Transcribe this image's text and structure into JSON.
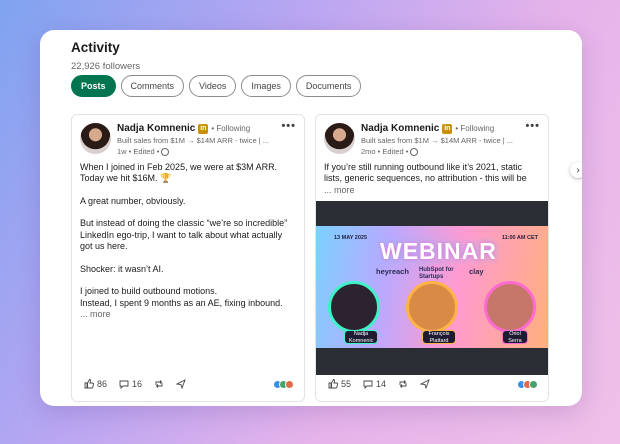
{
  "header": {
    "title": "Activity",
    "followers": "22,926 followers"
  },
  "tabs": [
    {
      "label": "Posts",
      "active": true
    },
    {
      "label": "Comments"
    },
    {
      "label": "Videos"
    },
    {
      "label": "Images"
    },
    {
      "label": "Documents"
    }
  ],
  "posts": [
    {
      "author": "Nadja Komnenic",
      "badge": "in",
      "following": "• Following",
      "headline": "Built sales from $1M → $14M ARR - twice | ...",
      "time": "1w • Edited •",
      "paragraphs": [
        "When I joined in Feb 2025, we were at $3M ARR. Today we hit $16M. 🏆",
        "A great number, obviously.",
        "But instead of doing the classic “we’re so incredible” LinkedIn ego-trip, I want to talk about what actually got us here.",
        "Shocker: it wasn’t AI.",
        "I joined to build outbound motions.\nInstead, I spent 9 months as an AE, fixing inbound."
      ],
      "see_more": "... more",
      "likes": "86",
      "comments": "16"
    },
    {
      "author": "Nadja Komnenic",
      "badge": "in",
      "following": "• Following",
      "headline": "Built sales from $1M → $14M ARR - twice | ...",
      "time": "2mo • Edited •",
      "paragraphs": [
        "If you’re still running outbound like it’s 2021, static lists, generic sequences, no attribution -  this will be"
      ],
      "see_more": "... more",
      "likes": "55",
      "comments": "14",
      "media": {
        "date": "13 MAY 2025",
        "time": "11:00 AM CET",
        "title": "WEBINAR",
        "logos": [
          "heyreach",
          "HubSpot for Startups",
          "clay"
        ],
        "speakers": [
          "Nadja Komnenic",
          "François Plattard",
          "Oriol Serra"
        ]
      }
    }
  ],
  "colors": {
    "accent": "#01754f",
    "badge": "#c8900b"
  }
}
